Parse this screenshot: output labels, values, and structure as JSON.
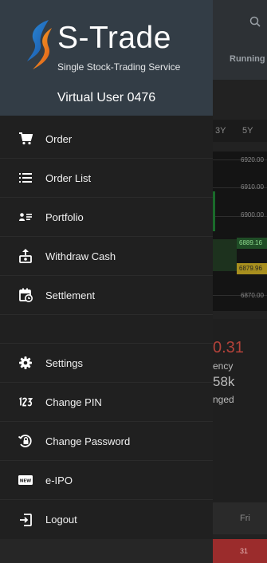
{
  "app": {
    "brand_title": "S-Trade",
    "brand_subtitle": "Single Stock-Trading Service",
    "user_name": "Virtual User 0476"
  },
  "menu": {
    "group1": [
      {
        "label": "Order",
        "icon": "cart-icon"
      },
      {
        "label": "Order List",
        "icon": "list-icon"
      },
      {
        "label": "Portfolio",
        "icon": "portfolio-icon"
      },
      {
        "label": "Withdraw Cash",
        "icon": "withdraw-cash-icon"
      },
      {
        "label": "Settlement",
        "icon": "calendar-clock-icon"
      }
    ],
    "group2": [
      {
        "label": "Settings",
        "icon": "gear-icon"
      },
      {
        "label": "Change PIN",
        "icon": "pin-123-icon"
      },
      {
        "label": "Change Password",
        "icon": "lock-reset-icon"
      },
      {
        "label": "e-IPO",
        "icon": "new-badge-icon"
      },
      {
        "label": "Logout",
        "icon": "logout-icon"
      }
    ]
  },
  "background": {
    "tab_label": "Running",
    "range_labels": [
      "3Y",
      "5Y"
    ],
    "prices": [
      "6920.00",
      "6910.00",
      "6900.00",
      "6889.16",
      "6879.96",
      "6870.00"
    ],
    "big_value": "0.31",
    "lines": [
      "ency",
      "58k",
      "nged"
    ],
    "day_label": "Fri",
    "date_label": "31"
  },
  "colors": {
    "header_bg": "#333d46",
    "drawer_bg": "#202020",
    "text": "#f1f1f1"
  }
}
